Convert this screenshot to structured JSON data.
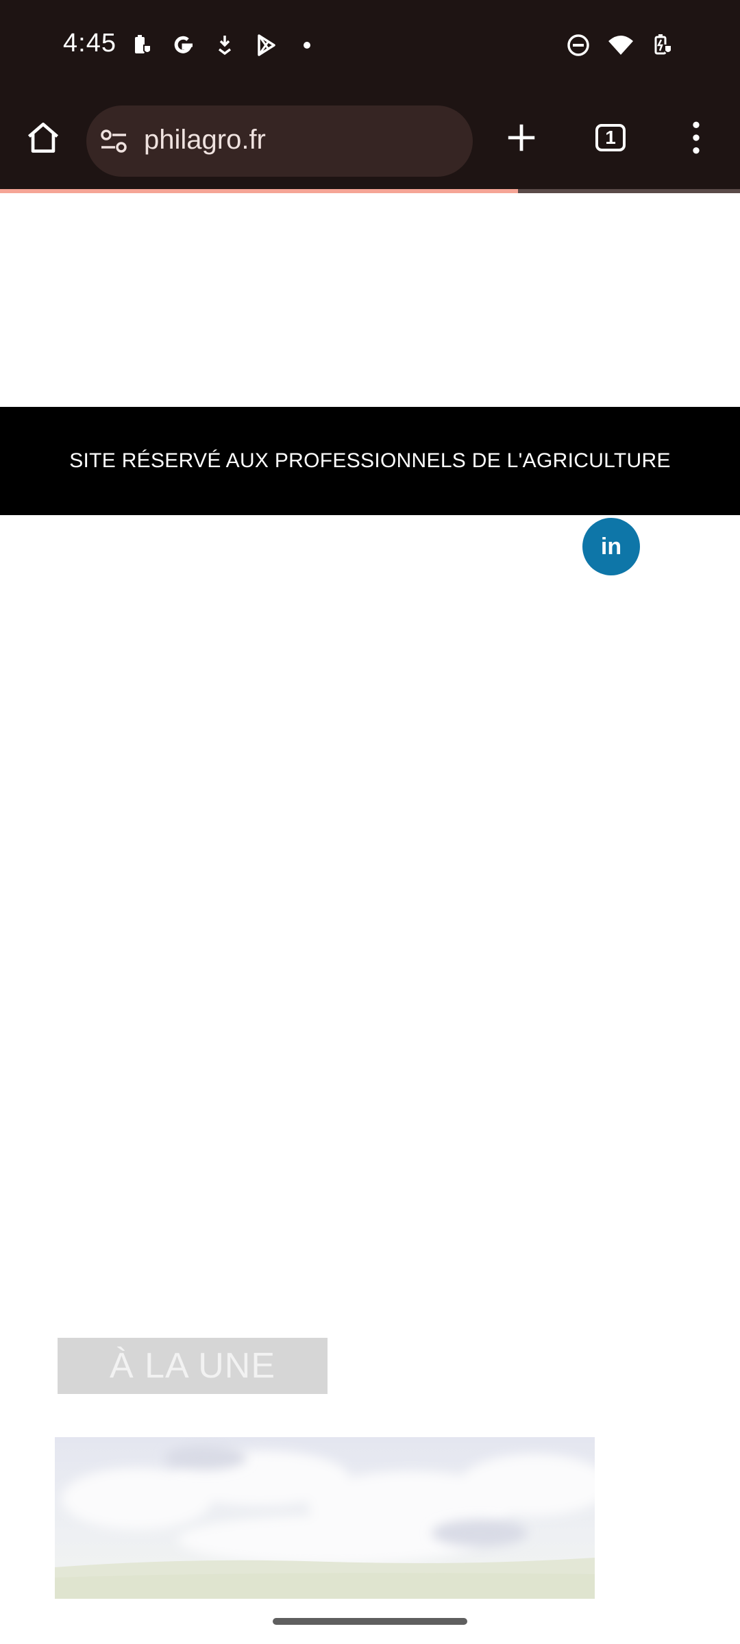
{
  "status_bar": {
    "time": "4:45",
    "icons_left": [
      "battery-saver-icon",
      "google-icon",
      "download-icon",
      "play-store-icon",
      "dot-icon"
    ],
    "icons_right": [
      "do-not-disturb-icon",
      "wifi-icon",
      "battery-charging-icon"
    ]
  },
  "browser": {
    "url": "philagro.fr",
    "tab_count": "1",
    "load_progress_percent": 70
  },
  "page": {
    "banner_text": "SITE RÉSERVÉ AUX PROFESSIONNELS DE L'AGRICULTURE",
    "linkedin_label": "in",
    "section_tag": "À LA UNE"
  },
  "colors": {
    "status_bg": "#1e1413",
    "url_bar_bg": "#362523",
    "progress": "#f5a596",
    "banner_bg": "#000000",
    "linkedin": "#0e76a8"
  }
}
